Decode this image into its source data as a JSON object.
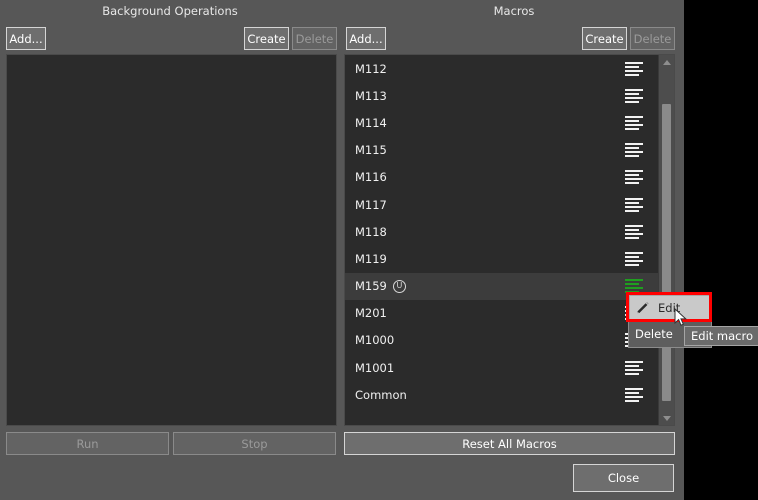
{
  "panels": {
    "background_operations": {
      "title": "Background Operations",
      "add_label": "Add...",
      "create_label": "Create",
      "delete_label": "Delete",
      "items": [],
      "run_label": "Run",
      "stop_label": "Stop"
    },
    "macros": {
      "title": "Macros",
      "add_label": "Add...",
      "create_label": "Create",
      "delete_label": "Delete",
      "reset_label": "Reset All Macros",
      "items": [
        {
          "label": "M112",
          "badge": "",
          "icon": "list-lines-icon",
          "selected": false
        },
        {
          "label": "M113",
          "badge": "",
          "icon": "list-lines-icon",
          "selected": false
        },
        {
          "label": "M114",
          "badge": "",
          "icon": "list-lines-icon",
          "selected": false
        },
        {
          "label": "M115",
          "badge": "",
          "icon": "list-lines-icon",
          "selected": false
        },
        {
          "label": "M116",
          "badge": "",
          "icon": "list-lines-icon",
          "selected": false
        },
        {
          "label": "M117",
          "badge": "",
          "icon": "list-lines-icon",
          "selected": false
        },
        {
          "label": "M118",
          "badge": "",
          "icon": "list-lines-icon",
          "selected": false
        },
        {
          "label": "M119",
          "badge": "",
          "icon": "list-lines-icon",
          "selected": false
        },
        {
          "label": "M159",
          "badge": "Ⓤ",
          "icon": "list-lines-green-icon",
          "selected": true
        },
        {
          "label": "M201",
          "badge": "",
          "icon": "list-lines-icon",
          "selected": false
        },
        {
          "label": "M1000",
          "badge": "",
          "icon": "list-lines-icon",
          "selected": false
        },
        {
          "label": "M1001",
          "badge": "",
          "icon": "list-lines-icon",
          "selected": false
        },
        {
          "label": "Common",
          "badge": "",
          "icon": "list-lines-icon",
          "selected": false
        }
      ]
    }
  },
  "context_menu": {
    "edit_label": "Edit",
    "delete_label": "Delete"
  },
  "tooltip": {
    "text": "Edit macro"
  },
  "footer": {
    "close_label": "Close"
  },
  "colors": {
    "dialog_background": "#575757",
    "list_background": "#2b2b2b",
    "selected_row": "#3c3c3c",
    "annotation_red": "#ff0000",
    "icon_green": "#1fa01f",
    "text_primary": "#f0f0f0",
    "text_disabled": "#9a9a9a"
  }
}
